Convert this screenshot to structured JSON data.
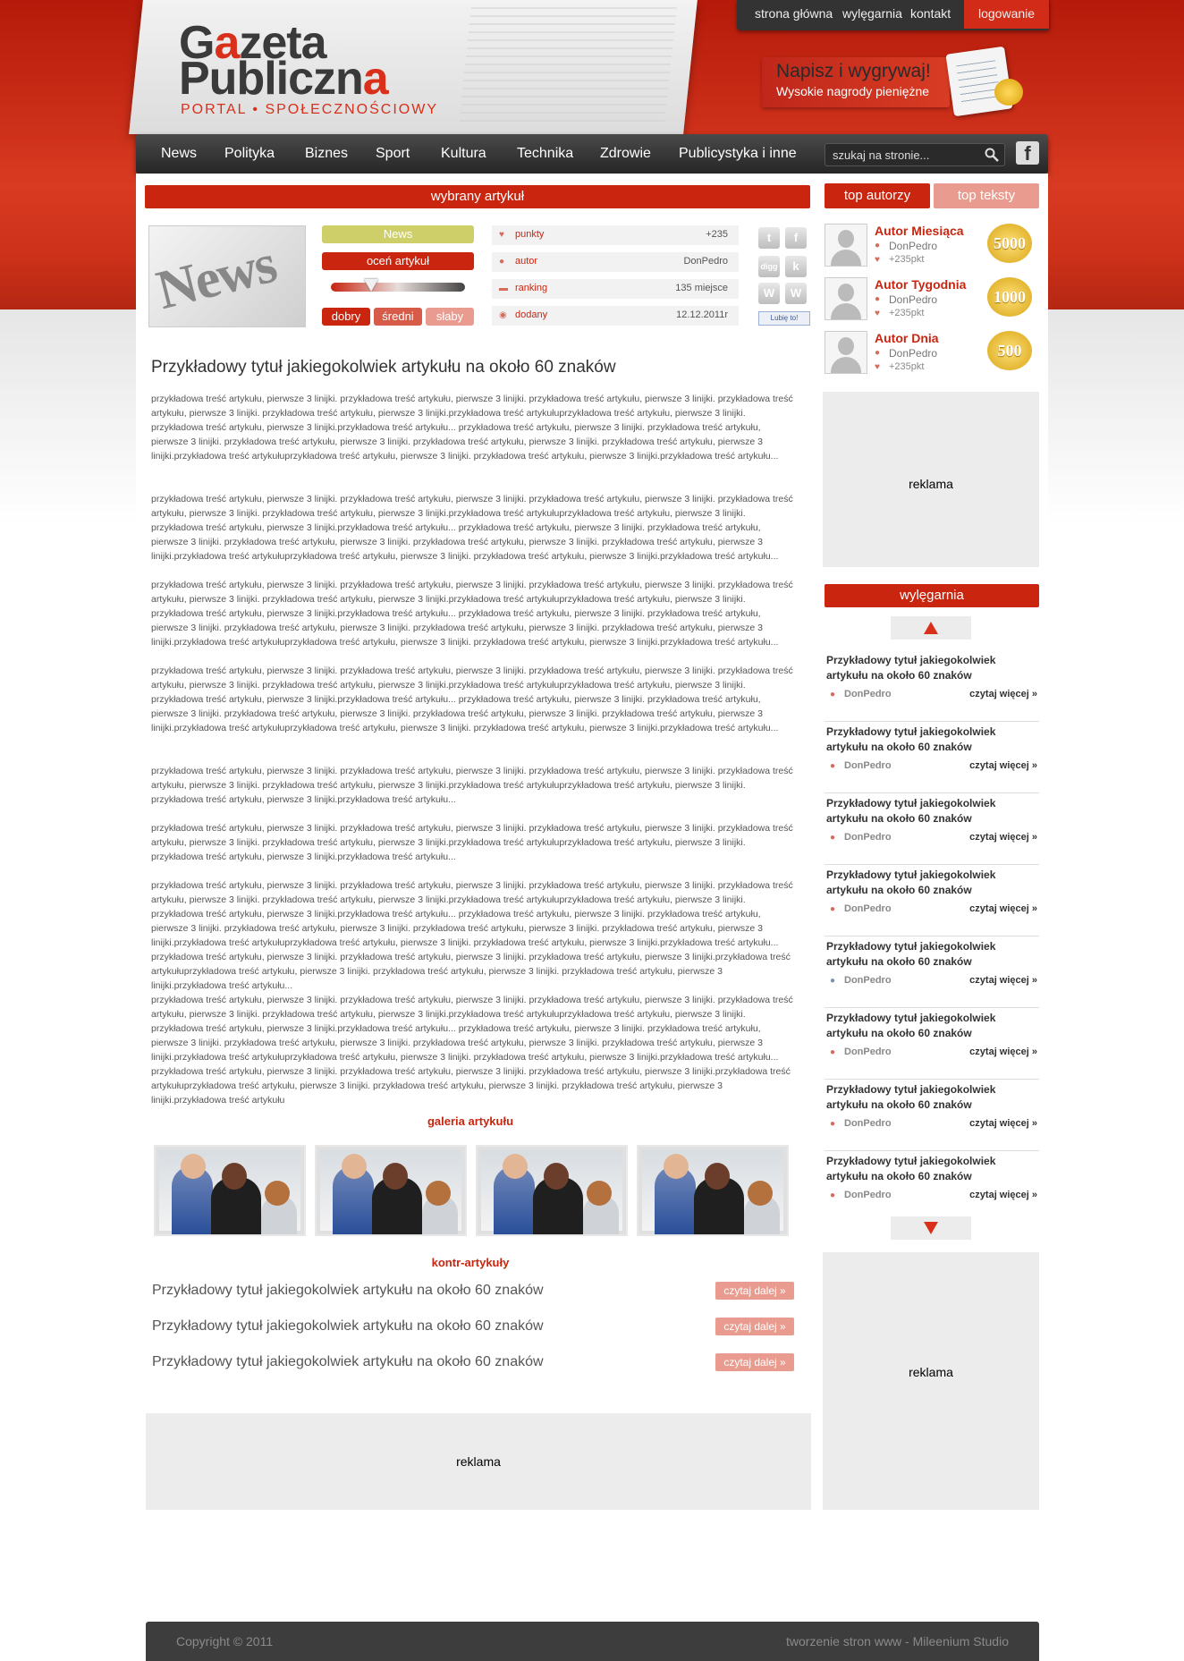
{
  "header": {
    "logo_line1_a": "G",
    "logo_line1_accent": "a",
    "logo_line1_b": "zeta",
    "logo_line2_a": "Publiczn",
    "logo_line2_accent": "a",
    "logo_sub": "PORTAL • SPOŁECZNOŚCIOWY",
    "top_nav": [
      "strona główna",
      "wylęgarnia",
      "kontakt"
    ],
    "login_label": "logowanie",
    "promo_title": "Napisz i wygrywaj!",
    "promo_sub": "Wysokie nagrody pieniężne"
  },
  "nav": {
    "items": [
      "News",
      "Polityka",
      "Biznes",
      "Sport",
      "Kultura",
      "Technika",
      "Zdrowie",
      "Publicystyka i inne"
    ],
    "search_placeholder": "szukaj na stronie...",
    "facebook_glyph": "f"
  },
  "article": {
    "section_label": "wybrany artykuł",
    "thumb_word": "News",
    "category": "News",
    "rate_label": "oceń artykuł",
    "rating_value": 0.3,
    "rate_buttons": [
      "dobry",
      "średni",
      "słaby"
    ],
    "stats": [
      {
        "label": "punkty",
        "value": "+235",
        "icon": "thumbs-icon"
      },
      {
        "label": "autor",
        "value": "DonPedro",
        "icon": "user-icon"
      },
      {
        "label": "ranking",
        "value": "135 miejsce",
        "icon": "ranking-icon"
      },
      {
        "label": "dodany",
        "value": "12.12.2011r",
        "icon": "clock-icon"
      }
    ],
    "social": [
      "t",
      "f",
      "digg",
      "k",
      "W",
      "W"
    ],
    "like_label": "Lubię to!",
    "title": "Przykładowy tytuł jakiegokolwiek artykułu na około 60 znaków",
    "paragraphs": [
      "przykładowa treść artykułu, pierwsze 3 linijki. przykładowa treść artykułu, pierwsze 3 linijki. przykładowa treść artykułu, pierwsze 3 linijki. przykładowa treść artykułu, pierwsze 3 linijki. przykładowa treść artykułu, pierwsze 3 linijki.przykładowa treść artykułuprzykładowa treść artykułu, pierwsze 3 linijki. przykładowa treść artykułu, pierwsze 3 linijki.przykładowa treść artykułu... przykładowa treść artykułu, pierwsze 3 linijki. przykładowa treść artykułu, pierwsze 3 linijki. przykładowa treść artykułu, pierwsze 3 linijki. przykładowa treść artykułu, pierwsze 3 linijki. przykładowa treść artykułu, pierwsze 3 linijki.przykładowa treść artykułuprzykładowa treść artykułu, pierwsze 3 linijki. przykładowa treść artykułu, pierwsze 3 linijki.przykładowa treść artykułu...",
      "przykładowa treść artykułu, pierwsze 3 linijki. przykładowa treść artykułu, pierwsze 3 linijki. przykładowa treść artykułu, pierwsze 3 linijki. przykładowa treść artykułu, pierwsze 3 linijki. przykładowa treść artykułu, pierwsze 3 linijki.przykładowa treść artykułuprzykładowa treść artykułu, pierwsze 3 linijki. przykładowa treść artykułu, pierwsze 3 linijki.przykładowa treść artykułu... przykładowa treść artykułu, pierwsze 3 linijki. przykładowa treść artykułu, pierwsze 3 linijki. przykładowa treść artykułu, pierwsze 3 linijki. przykładowa treść artykułu, pierwsze 3 linijki. przykładowa treść artykułu, pierwsze 3 linijki.przykładowa treść artykułuprzykładowa treść artykułu, pierwsze 3 linijki. przykładowa treść artykułu, pierwsze 3 linijki.przykładowa treść artykułu...",
      "przykładowa treść artykułu, pierwsze 3 linijki. przykładowa treść artykułu, pierwsze 3 linijki. przykładowa treść artykułu, pierwsze 3 linijki. przykładowa treść artykułu, pierwsze 3 linijki. przykładowa treść artykułu, pierwsze 3 linijki.przykładowa treść artykułuprzykładowa treść artykułu, pierwsze 3 linijki. przykładowa treść artykułu, pierwsze 3 linijki.przykładowa treść artykułu... przykładowa treść artykułu, pierwsze 3 linijki. przykładowa treść artykułu, pierwsze 3 linijki. przykładowa treść artykułu, pierwsze 3 linijki. przykładowa treść artykułu, pierwsze 3 linijki. przykładowa treść artykułu, pierwsze 3 linijki.przykładowa treść artykułuprzykładowa treść artykułu, pierwsze 3 linijki. przykładowa treść artykułu, pierwsze 3 linijki.przykładowa treść artykułu...",
      "przykładowa treść artykułu, pierwsze 3 linijki. przykładowa treść artykułu, pierwsze 3 linijki. przykładowa treść artykułu, pierwsze 3 linijki. przykładowa treść artykułu, pierwsze 3 linijki. przykładowa treść artykułu, pierwsze 3 linijki.przykładowa treść artykułuprzykładowa treść artykułu, pierwsze 3 linijki. przykładowa treść artykułu, pierwsze 3 linijki.przykładowa treść artykułu... przykładowa treść artykułu, pierwsze 3 linijki. przykładowa treść artykułu, pierwsze 3 linijki. przykładowa treść artykułu, pierwsze 3 linijki. przykładowa treść artykułu, pierwsze 3 linijki. przykładowa treść artykułu, pierwsze 3 linijki.przykładowa treść artykułuprzykładowa treść artykułu, pierwsze 3 linijki. przykładowa treść artykułu, pierwsze 3 linijki.przykładowa treść artykułu...",
      "przykładowa treść artykułu, pierwsze 3 linijki. przykładowa treść artykułu, pierwsze 3 linijki. przykładowa treść artykułu, pierwsze 3 linijki. przykładowa treść artykułu, pierwsze 3 linijki. przykładowa treść artykułu, pierwsze 3 linijki.przykładowa treść artykułuprzykładowa treść artykułu, pierwsze 3 linijki. przykładowa treść artykułu, pierwsze 3 linijki.przykładowa treść artykułu...",
      "przykładowa treść artykułu, pierwsze 3 linijki. przykładowa treść artykułu, pierwsze 3 linijki. przykładowa treść artykułu, pierwsze 3 linijki. przykładowa treść artykułu, pierwsze 3 linijki. przykładowa treść artykułu, pierwsze 3 linijki.przykładowa treść artykułuprzykładowa treść artykułu, pierwsze 3 linijki. przykładowa treść artykułu, pierwsze 3 linijki.przykładowa treść artykułu...",
      "przykładowa treść artykułu, pierwsze 3 linijki. przykładowa treść artykułu, pierwsze 3 linijki. przykładowa treść artykułu, pierwsze 3 linijki. przykładowa treść artykułu, pierwsze 3 linijki. przykładowa treść artykułu, pierwsze 3 linijki.przykładowa treść artykułuprzykładowa treść artykułu, pierwsze 3 linijki. przykładowa treść artykułu, pierwsze 3 linijki.przykładowa treść artykułu... przykładowa treść artykułu, pierwsze 3 linijki. przykładowa treść artykułu, pierwsze 3 linijki. przykładowa treść artykułu, pierwsze 3 linijki. przykładowa treść artykułu, pierwsze 3 linijki. przykładowa treść artykułu, pierwsze 3 linijki.przykładowa treść artykułuprzykładowa treść artykułu, pierwsze 3 linijki. przykładowa treść artykułu, pierwsze 3 linijki.przykładowa treść artykułu... przykładowa treść artykułu, pierwsze 3 linijki. przykładowa treść artykułu, pierwsze 3 linijki. przykładowa treść artykułu, pierwsze 3 linijki.przykładowa treść artykułuprzykładowa treść artykułu, pierwsze 3 linijki. przykładowa treść artykułu, pierwsze 3 linijki. przykładowa treść artykułu, pierwsze 3 linijki.przykładowa treść artykułu...",
      "przykładowa treść artykułu, pierwsze 3 linijki. przykładowa treść artykułu, pierwsze 3 linijki. przykładowa treść artykułu, pierwsze 3 linijki. przykładowa treść artykułu, pierwsze 3 linijki. przykładowa treść artykułu, pierwsze 3 linijki.przykładowa treść artykułuprzykładowa treść artykułu, pierwsze 3 linijki. przykładowa treść artykułu, pierwsze 3 linijki.przykładowa treść artykułu... przykładowa treść artykułu, pierwsze 3 linijki. przykładowa treść artykułu, pierwsze 3 linijki. przykładowa treść artykułu, pierwsze 3 linijki. przykładowa treść artykułu, pierwsze 3 linijki. przykładowa treść artykułu, pierwsze 3 linijki.przykładowa treść artykułuprzykładowa treść artykułu, pierwsze 3 linijki. przykładowa treść artykułu, pierwsze 3 linijki.przykładowa treść artykułu... przykładowa treść artykułu, pierwsze 3 linijki. przykładowa treść artykułu, pierwsze 3 linijki. przykładowa treść artykułu, pierwsze 3 linijki.przykładowa treść artykułuprzykładowa treść artykułu, pierwsze 3 linijki. przykładowa treść artykułu, pierwsze 3 linijki. przykładowa treść artykułu, pierwsze 3 linijki.przykładowa treść artykułu"
    ],
    "gallery_label": "galeria artykułu",
    "kontr_label": "kontr-artykuły",
    "kontr": [
      {
        "title": "Przykładowy tytuł jakiegokolwiek artykułu na około 60 znaków",
        "btn": "czytaj dalej »"
      },
      {
        "title": "Przykładowy tytuł jakiegokolwiek artykułu na około 60 znaków",
        "btn": "czytaj dalej »"
      },
      {
        "title": "Przykładowy tytuł jakiegokolwiek artykułu na około 60 znaków",
        "btn": "czytaj dalej »"
      }
    ],
    "ad_label": "reklama"
  },
  "sidebar": {
    "tabs": [
      "top autorzy",
      "top teksty"
    ],
    "authors": [
      {
        "title": "Autor Miesiąca",
        "name": "DonPedro",
        "points": "+235pkt",
        "medal": "5000"
      },
      {
        "title": "Autor Tygodnia",
        "name": "DonPedro",
        "points": "+235pkt",
        "medal": "1000"
      },
      {
        "title": "Autor Dnia",
        "name": "DonPedro",
        "points": "+235pkt",
        "medal": "500"
      }
    ],
    "ad1": "reklama",
    "wylegarnia_label": "wylęgarnia",
    "wylegarnia": [
      {
        "title": "Przykładowy tytuł jakiegokolwiek artykułu na około 60 znaków",
        "author": "DonPedro",
        "more": "czytaj więcej »"
      },
      {
        "title": "Przykładowy tytuł jakiegokolwiek artykułu na około 60 znaków",
        "author": "DonPedro",
        "more": "czytaj więcej »"
      },
      {
        "title": "Przykładowy tytuł jakiegokolwiek artykułu na około 60 znaków",
        "author": "DonPedro",
        "more": "czytaj więcej »"
      },
      {
        "title": "Przykładowy tytuł jakiegokolwiek artykułu na około 60 znaków",
        "author": "DonPedro",
        "more": "czytaj więcej »"
      },
      {
        "title": "Przykładowy tytuł jakiegokolwiek artykułu na około 60 znaków",
        "author": "DonPedro",
        "more": "czytaj więcej »"
      },
      {
        "title": "Przykładowy tytuł jakiegokolwiek artykułu na około 60 znaków",
        "author": "DonPedro",
        "more": "czytaj więcej »"
      },
      {
        "title": "Przykładowy tytuł jakiegokolwiek artykułu na około 60 znaków",
        "author": "DonPedro",
        "more": "czytaj więcej »"
      },
      {
        "title": "Przykładowy tytuł jakiegokolwiek artykułu na około 60 znaków",
        "author": "DonPedro",
        "more": "czytaj więcej »"
      }
    ],
    "ad2": "reklama"
  },
  "footer": {
    "copyright": "Copyright © 2011",
    "credit": "tworzenie stron www - Mileenium Studio"
  },
  "colors": {
    "accent": "#c9250f",
    "accent_light": "#e89b8e",
    "dark": "#333333"
  }
}
